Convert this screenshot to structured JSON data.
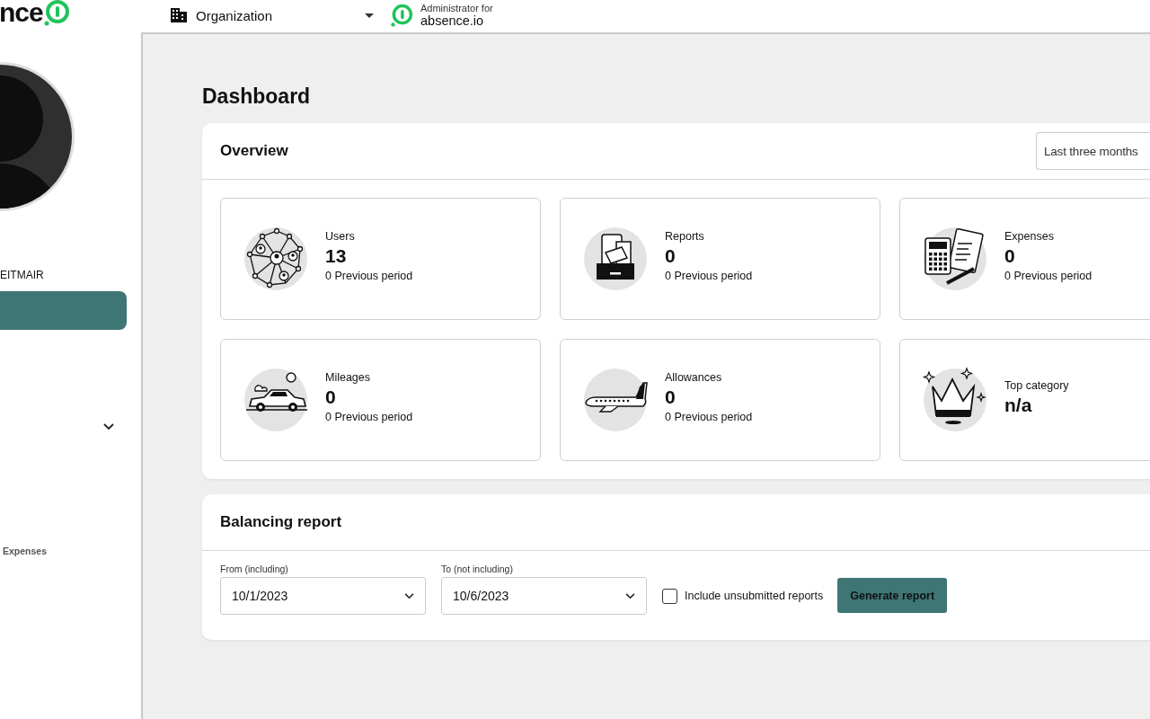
{
  "brand": {
    "text": "nce"
  },
  "org_selector": {
    "label": "Organization"
  },
  "account": {
    "role": "Administrator for",
    "name": "absence.io"
  },
  "sidebar": {
    "user_name": "EITMAIR",
    "section_label": "Expenses"
  },
  "page_title": "Dashboard",
  "overview": {
    "title": "Overview",
    "period": "Last three months",
    "tiles": [
      {
        "kind": "users",
        "label": "Users",
        "value": "13",
        "previous": "0 Previous period"
      },
      {
        "kind": "reports",
        "label": "Reports",
        "value": "0",
        "previous": "0 Previous period"
      },
      {
        "kind": "expenses",
        "label": "Expenses",
        "value": "0",
        "previous": "0 Previous period"
      },
      {
        "kind": "mileages",
        "label": "Mileages",
        "value": "0",
        "previous": "0 Previous period"
      },
      {
        "kind": "allowances",
        "label": "Allowances",
        "value": "0",
        "previous": "0 Previous period"
      },
      {
        "kind": "category",
        "label": "Top category",
        "value": "n/a"
      }
    ]
  },
  "balancing_report": {
    "title": "Balancing report",
    "from": {
      "label": "From (including)",
      "value": "10/1/2023"
    },
    "to": {
      "label": "To (not including)",
      "value": "10/6/2023"
    },
    "include_unsubmitted": {
      "label": "Include unsubmitted reports",
      "checked": false
    },
    "generate_button": "Generate report"
  }
}
